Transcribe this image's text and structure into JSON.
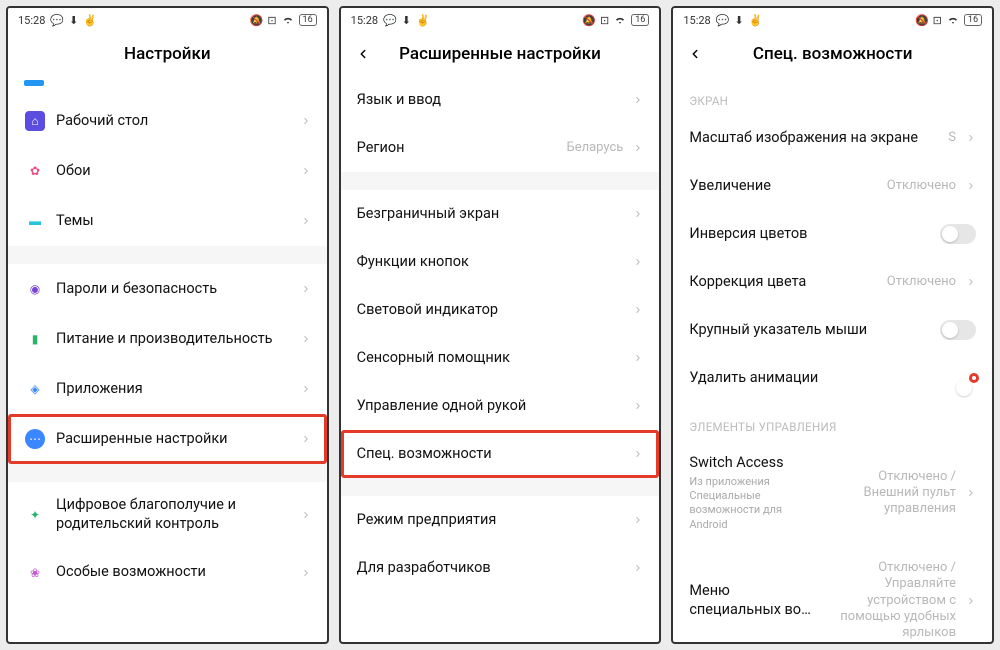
{
  "status": {
    "time": "15:28",
    "battery": "16"
  },
  "screen1": {
    "title": "Настройки",
    "items": {
      "desktop": "Рабочий стол",
      "wallpaper": "Обои",
      "themes": "Темы",
      "passwords": "Пароли и безопасность",
      "power": "Питание и производительность",
      "apps": "Приложения",
      "advanced": "Расширенные настройки",
      "digital": "Цифровое благополучие и родительский контроль",
      "special": "Особые возможности"
    }
  },
  "screen2": {
    "title": "Расширенные настройки",
    "items": {
      "lang": "Язык и ввод",
      "region": "Регион",
      "region_val": "Беларусь",
      "fullscreen": "Безграничный экран",
      "buttons": "Функции кнопок",
      "led": "Световой индикатор",
      "touch": "Сенсорный помощник",
      "onehand": "Управление одной рукой",
      "access": "Спец. возможности",
      "enterprise": "Режим предприятия",
      "dev": "Для разработчиков"
    }
  },
  "screen3": {
    "title": "Спец. возможности",
    "section_screen": "ЭКРАН",
    "section_controls": "ЭЛЕМЕНТЫ УПРАВЛЕНИЯ",
    "items": {
      "scale": "Масштаб изображения на экране",
      "scale_val": "S",
      "magnify": "Увеличение",
      "magnify_val": "Отключено",
      "invert": "Инверсия цветов",
      "colorcorr": "Коррекция цвета",
      "colorcorr_val": "Отключено",
      "bigmouse": "Крупный указатель мыши",
      "removeanim": "Удалить анимации",
      "switchaccess": "Switch Access",
      "switchaccess_sub": "Из приложения Специальные возможности для Android",
      "switchaccess_val": "Отключено / Внешний пульт управления",
      "menu": "Меню специальных во…",
      "menu_val": "Отключено / Управляйте устройством с помощью удобных ярлыков"
    }
  }
}
